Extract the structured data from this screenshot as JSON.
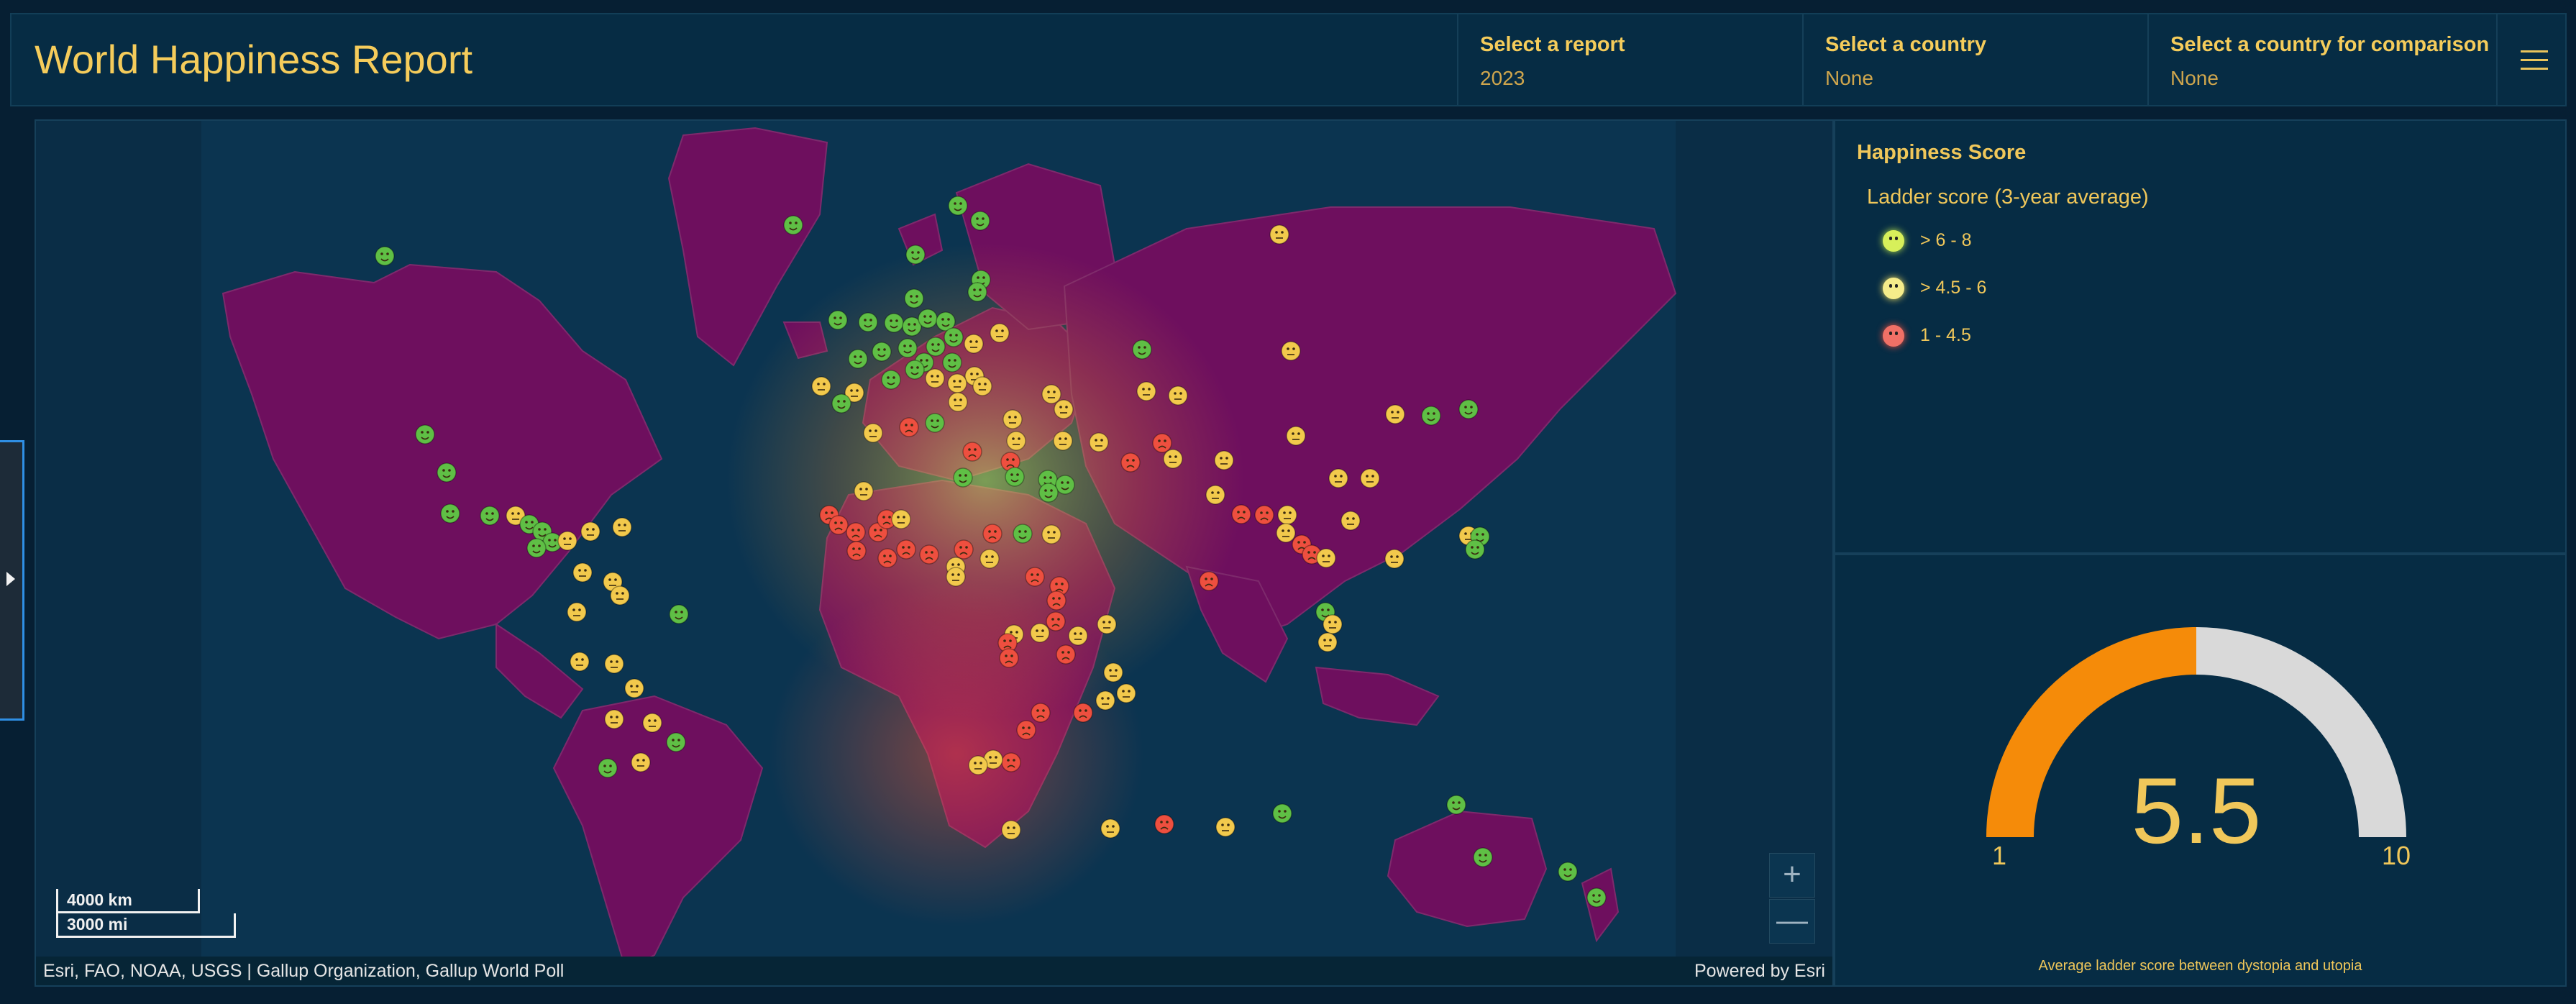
{
  "app_title": "World Happiness Report",
  "selectors": [
    {
      "label": "Select a report",
      "value": "2023"
    },
    {
      "label": "Select a country",
      "value": "None"
    },
    {
      "label": "Select a country for comparison",
      "value": "None"
    }
  ],
  "map": {
    "scale_km": "4000 km",
    "scale_mi": "3000 mi",
    "attribution": "Esri, FAO, NOAA, USGS | Gallup Organization, Gallup World Poll",
    "powered_by": "Powered by Esri",
    "zoom_in": "+",
    "zoom_out": "—"
  },
  "legend": {
    "title": "Happiness Score",
    "subtitle": "Ladder score (3-year average)",
    "items": [
      {
        "label": "> 6 - 8",
        "color": "#7fe04a"
      },
      {
        "label": "> 4.5 - 6",
        "color": "#f2e27a"
      },
      {
        "label": "1 - 4.5",
        "color": "#f05a4a"
      }
    ]
  },
  "gauge": {
    "value": "5.5",
    "min": "1",
    "max": "10",
    "caption": "Average ladder score between dystopia and utopia",
    "fill_color": "#f58b09",
    "track_color": "#d9d9d9"
  },
  "colors": {
    "land": "#6e0f5e",
    "ocean": "#0a2e47",
    "happy": "#5fbf45",
    "neutral": "#f2c94c",
    "sad": "#ee4f3f"
  }
}
